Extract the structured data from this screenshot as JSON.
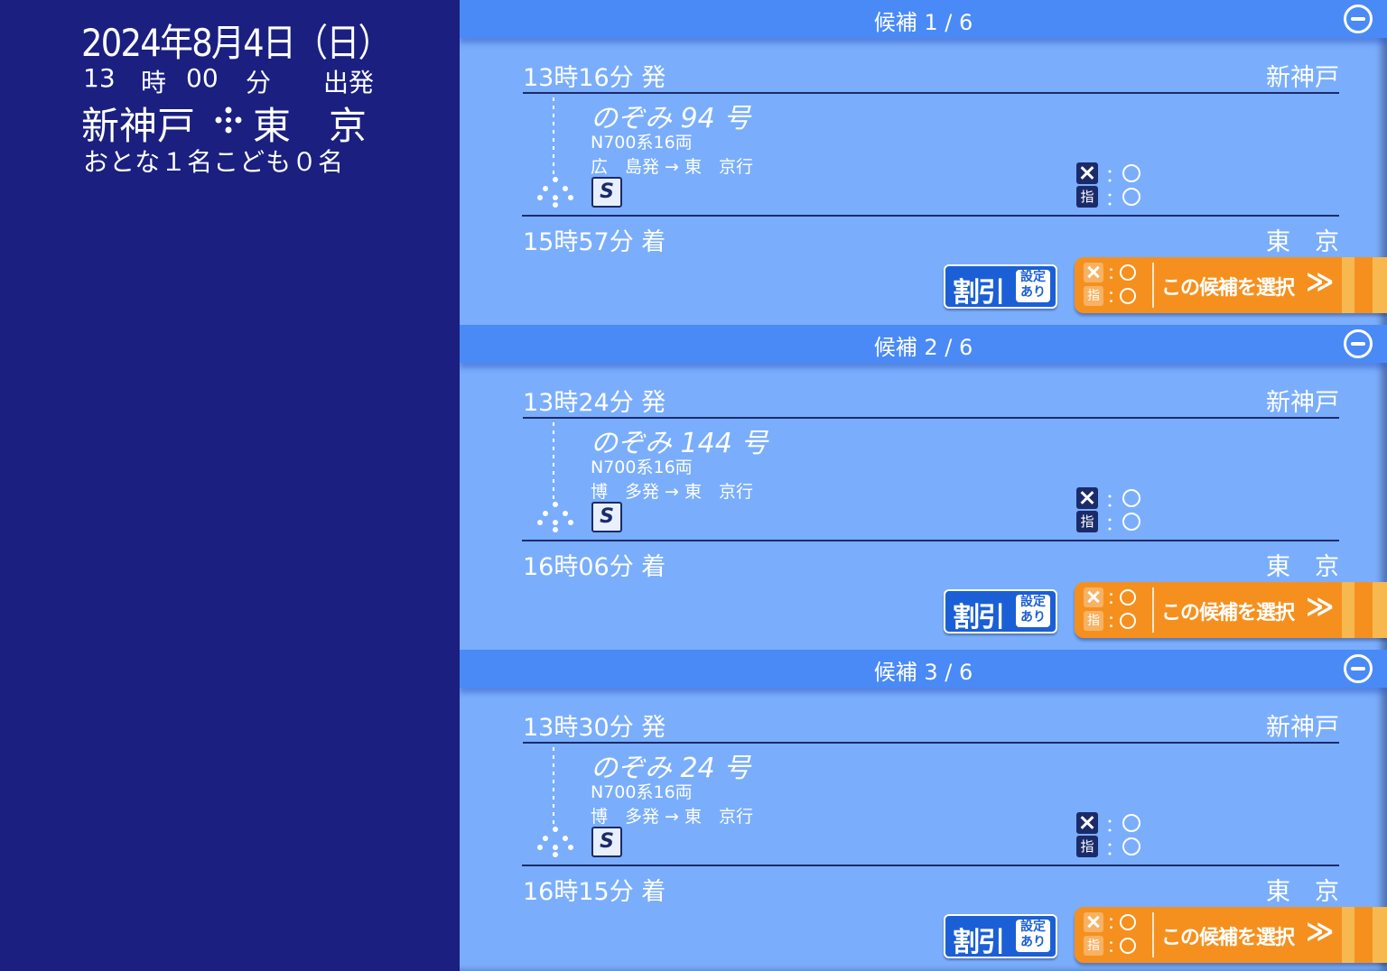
{
  "summary": {
    "date": "2024年8月4日（日）",
    "hour": "13",
    "hour_unit": "時",
    "minute": "00",
    "minute_unit": "分",
    "mode": "出発",
    "from": "新神戸",
    "to": "東　京",
    "passengers": "おとな１名こども０名"
  },
  "candidates": [
    {
      "title": "候補 1 / 6",
      "dep_time": "13時16分 発",
      "dep_station": "新神戸",
      "train_name": "のぞみ 94 号",
      "train_cars": "N700系16両",
      "train_route": "広　島発 → 東　京行",
      "s_icon": "S",
      "seat_free_label": "：",
      "seat_free_status": "○",
      "seat_res_icon": "指",
      "seat_res_label": "：",
      "seat_res_status": "○",
      "arr_time": "15時57分 着",
      "arr_station": "東　京",
      "discount_main": "割引",
      "discount_sub": "設定あり",
      "select_label": "この候補を選択",
      "select_chevron": "≫"
    },
    {
      "title": "候補 2 / 6",
      "dep_time": "13時24分 発",
      "dep_station": "新神戸",
      "train_name": "のぞみ 144 号",
      "train_cars": "N700系16両",
      "train_route": "博　多発 → 東　京行",
      "s_icon": "S",
      "seat_free_label": "：",
      "seat_free_status": "○",
      "seat_res_icon": "指",
      "seat_res_label": "：",
      "seat_res_status": "○",
      "arr_time": "16時06分 着",
      "arr_station": "東　京",
      "discount_main": "割引",
      "discount_sub": "設定あり",
      "select_label": "この候補を選択",
      "select_chevron": "≫"
    },
    {
      "title": "候補 3 / 6",
      "dep_time": "13時30分 発",
      "dep_station": "新神戸",
      "train_name": "のぞみ 24 号",
      "train_cars": "N700系16両",
      "train_route": "博　多発 → 東　京行",
      "s_icon": "S",
      "seat_free_label": "：",
      "seat_free_status": "○",
      "seat_res_icon": "指",
      "seat_res_label": "：",
      "seat_res_status": "○",
      "arr_time": "16時15分 着",
      "arr_station": "東　京",
      "discount_main": "割引",
      "discount_sub": "設定あり",
      "select_label": "この候補を選択",
      "select_chevron": "≫"
    }
  ],
  "icons": {
    "collapse": "minus-circle-icon",
    "route_arrow": "dotted-down-arrow-icon",
    "route_connector": "four-dot-diamond-icon",
    "seat_free": "non-reserved-seat-icon",
    "seat_reserved": "reserved-seat-icon"
  },
  "colors": {
    "summary_bg": "#1a1f80",
    "list_bg": "#7aaefc",
    "header_bg": "#4a8af7",
    "select_btn": "#f5901e",
    "discount_btn": "#1b5fd6"
  }
}
